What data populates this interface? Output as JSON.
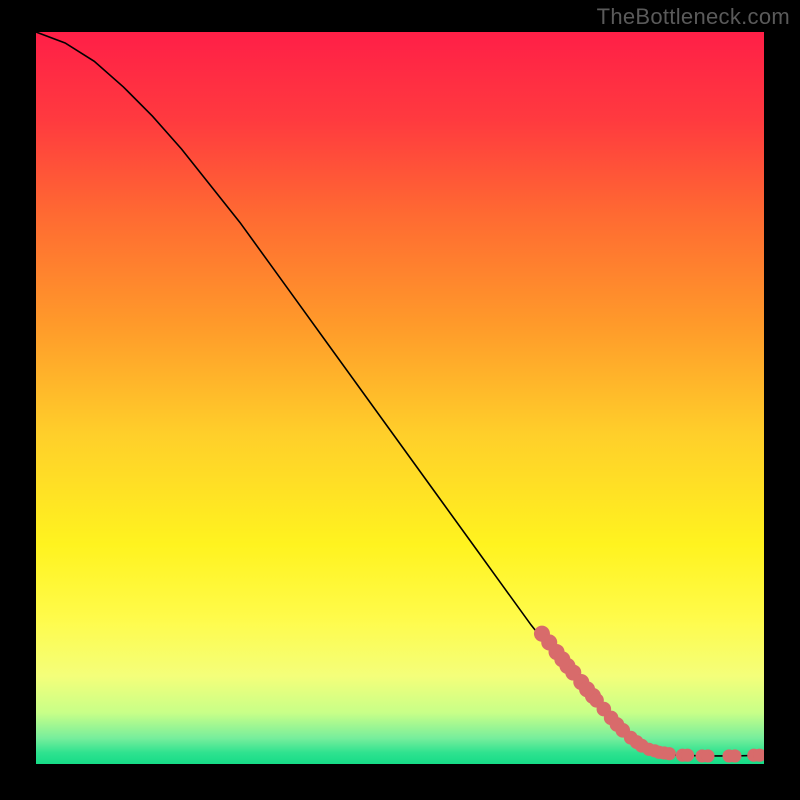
{
  "watermark": "TheBottleneck.com",
  "chart_data": {
    "type": "line",
    "title": "",
    "xlabel": "",
    "ylabel": "",
    "xlim": [
      0,
      100
    ],
    "ylim": [
      0,
      100
    ],
    "grid": false,
    "legend": false,
    "curve": {
      "name": "bottleneck-curve",
      "x": [
        0,
        4,
        8,
        12,
        16,
        20,
        24,
        28,
        32,
        36,
        40,
        44,
        48,
        52,
        56,
        60,
        64,
        68,
        72,
        76,
        80,
        84,
        88,
        92,
        96,
        100
      ],
      "y": [
        100,
        98.5,
        96,
        92.5,
        88.5,
        84,
        79,
        74,
        68.5,
        63,
        57.5,
        52,
        46.5,
        41,
        35.5,
        30,
        24.5,
        19,
        14,
        9,
        5,
        2.3,
        1.2,
        1.1,
        1.1,
        1.2
      ]
    },
    "markers": {
      "name": "highlighted-points",
      "color": "#d86b6b",
      "radius_base": 0.9,
      "points": [
        {
          "x": 69.5,
          "y": 17.8,
          "r": 1.1
        },
        {
          "x": 70.5,
          "y": 16.6,
          "r": 1.1
        },
        {
          "x": 71.5,
          "y": 15.3,
          "r": 1.1
        },
        {
          "x": 72.3,
          "y": 14.3,
          "r": 1.1
        },
        {
          "x": 73.0,
          "y": 13.4,
          "r": 1.1
        },
        {
          "x": 73.8,
          "y": 12.5,
          "r": 1.1
        },
        {
          "x": 74.9,
          "y": 11.2,
          "r": 1.1
        },
        {
          "x": 75.7,
          "y": 10.2,
          "r": 1.1
        },
        {
          "x": 76.5,
          "y": 9.3,
          "r": 1.1
        },
        {
          "x": 77.0,
          "y": 8.7,
          "r": 1.0
        },
        {
          "x": 78.0,
          "y": 7.5,
          "r": 1.0
        },
        {
          "x": 79.0,
          "y": 6.3,
          "r": 1.0
        },
        {
          "x": 79.8,
          "y": 5.4,
          "r": 1.0
        },
        {
          "x": 80.6,
          "y": 4.6,
          "r": 1.0
        },
        {
          "x": 81.7,
          "y": 3.6,
          "r": 0.95
        },
        {
          "x": 82.5,
          "y": 3.0,
          "r": 0.95
        },
        {
          "x": 83.2,
          "y": 2.5,
          "r": 0.95
        },
        {
          "x": 84.2,
          "y": 2.0,
          "r": 0.9
        },
        {
          "x": 85.0,
          "y": 1.8,
          "r": 0.9
        },
        {
          "x": 85.6,
          "y": 1.6,
          "r": 0.9
        },
        {
          "x": 86.3,
          "y": 1.5,
          "r": 0.9
        },
        {
          "x": 87.0,
          "y": 1.4,
          "r": 0.9
        },
        {
          "x": 88.8,
          "y": 1.2,
          "r": 0.9
        },
        {
          "x": 89.5,
          "y": 1.2,
          "r": 0.9
        },
        {
          "x": 91.5,
          "y": 1.1,
          "r": 0.9
        },
        {
          "x": 92.3,
          "y": 1.1,
          "r": 0.9
        },
        {
          "x": 95.2,
          "y": 1.1,
          "r": 0.9
        },
        {
          "x": 96.0,
          "y": 1.1,
          "r": 0.9
        },
        {
          "x": 98.6,
          "y": 1.2,
          "r": 0.9
        },
        {
          "x": 99.4,
          "y": 1.2,
          "r": 0.9
        }
      ]
    },
    "background_gradient": {
      "stops": [
        {
          "offset": 0.0,
          "color": "#ff1f47"
        },
        {
          "offset": 0.12,
          "color": "#ff3a3f"
        },
        {
          "offset": 0.25,
          "color": "#ff6a32"
        },
        {
          "offset": 0.4,
          "color": "#ff9a2a"
        },
        {
          "offset": 0.55,
          "color": "#ffcf2a"
        },
        {
          "offset": 0.7,
          "color": "#fff31f"
        },
        {
          "offset": 0.8,
          "color": "#fffb4a"
        },
        {
          "offset": 0.88,
          "color": "#f4ff7a"
        },
        {
          "offset": 0.93,
          "color": "#c8ff88"
        },
        {
          "offset": 0.965,
          "color": "#76ee9c"
        },
        {
          "offset": 0.985,
          "color": "#2ee28f"
        },
        {
          "offset": 1.0,
          "color": "#16dc87"
        }
      ]
    }
  }
}
